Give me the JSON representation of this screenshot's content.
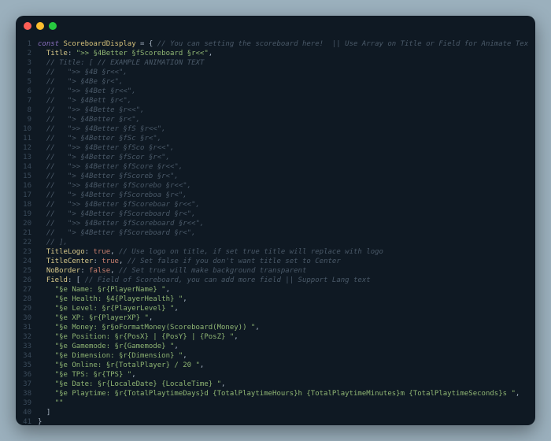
{
  "traffic_lights": [
    "red",
    "yellow",
    "green"
  ],
  "code": {
    "lines": [
      {
        "n": 1,
        "tokens": [
          {
            "c": "t-kw",
            "t": "const "
          },
          {
            "c": "t-var",
            "t": "ScoreboardDisplay"
          },
          {
            "c": "t-punc",
            "t": " = { "
          },
          {
            "c": "t-cmt",
            "t": "// You can setting the scoreboard here!  || Use Array on Title or Field for Animate Text"
          }
        ]
      },
      {
        "n": 2,
        "tokens": [
          {
            "c": "t-punc",
            "t": "  "
          },
          {
            "c": "t-prop",
            "t": "Title"
          },
          {
            "c": "t-punc",
            "t": ": "
          },
          {
            "c": "t-str",
            "t": "\">> §4Better §fScoreboard §r<<\""
          },
          {
            "c": "t-punc",
            "t": ","
          }
        ]
      },
      {
        "n": 3,
        "tokens": [
          {
            "c": "t-punc",
            "t": "  "
          },
          {
            "c": "t-cmt",
            "t": "// Title: [ // EXAMPLE ANIMATION TEXT"
          }
        ]
      },
      {
        "n": 4,
        "tokens": [
          {
            "c": "t-punc",
            "t": "  "
          },
          {
            "c": "t-cmt",
            "t": "//   \">> §4B §r<<\","
          }
        ]
      },
      {
        "n": 5,
        "tokens": [
          {
            "c": "t-punc",
            "t": "  "
          },
          {
            "c": "t-cmt",
            "t": "//   \"> §4Be §r<\","
          }
        ]
      },
      {
        "n": 6,
        "tokens": [
          {
            "c": "t-punc",
            "t": "  "
          },
          {
            "c": "t-cmt",
            "t": "//   \">> §4Bet §r<<\","
          }
        ]
      },
      {
        "n": 7,
        "tokens": [
          {
            "c": "t-punc",
            "t": "  "
          },
          {
            "c": "t-cmt",
            "t": "//   \"> §4Bett §r<\","
          }
        ]
      },
      {
        "n": 8,
        "tokens": [
          {
            "c": "t-punc",
            "t": "  "
          },
          {
            "c": "t-cmt",
            "t": "//   \">> §4Bette §r<<\","
          }
        ]
      },
      {
        "n": 9,
        "tokens": [
          {
            "c": "t-punc",
            "t": "  "
          },
          {
            "c": "t-cmt",
            "t": "//   \"> §4Better §r<\","
          }
        ]
      },
      {
        "n": 10,
        "tokens": [
          {
            "c": "t-punc",
            "t": "  "
          },
          {
            "c": "t-cmt",
            "t": "//   \">> §4Better §fS §r<<\","
          }
        ]
      },
      {
        "n": 11,
        "tokens": [
          {
            "c": "t-punc",
            "t": "  "
          },
          {
            "c": "t-cmt",
            "t": "//   \"> §4Better §fSc §r<\","
          }
        ]
      },
      {
        "n": 12,
        "tokens": [
          {
            "c": "t-punc",
            "t": "  "
          },
          {
            "c": "t-cmt",
            "t": "//   \">> §4Better §fSco §r<<\","
          }
        ]
      },
      {
        "n": 13,
        "tokens": [
          {
            "c": "t-punc",
            "t": "  "
          },
          {
            "c": "t-cmt",
            "t": "//   \"> §4Better §fScor §r<\","
          }
        ]
      },
      {
        "n": 14,
        "tokens": [
          {
            "c": "t-punc",
            "t": "  "
          },
          {
            "c": "t-cmt",
            "t": "//   \">> §4Better §fScore §r<<\","
          }
        ]
      },
      {
        "n": 15,
        "tokens": [
          {
            "c": "t-punc",
            "t": "  "
          },
          {
            "c": "t-cmt",
            "t": "//   \"> §4Better §fScoreb §r<\","
          }
        ]
      },
      {
        "n": 16,
        "tokens": [
          {
            "c": "t-punc",
            "t": "  "
          },
          {
            "c": "t-cmt",
            "t": "//   \">> §4Better §fScorebo §r<<\","
          }
        ]
      },
      {
        "n": 17,
        "tokens": [
          {
            "c": "t-punc",
            "t": "  "
          },
          {
            "c": "t-cmt",
            "t": "//   \"> §4Better §fScoreboa §r<\","
          }
        ]
      },
      {
        "n": 18,
        "tokens": [
          {
            "c": "t-punc",
            "t": "  "
          },
          {
            "c": "t-cmt",
            "t": "//   \">> §4Better §fScoreboar §r<<\","
          }
        ]
      },
      {
        "n": 19,
        "tokens": [
          {
            "c": "t-punc",
            "t": "  "
          },
          {
            "c": "t-cmt",
            "t": "//   \"> §4Better §fScoreboard §r<\","
          }
        ]
      },
      {
        "n": 20,
        "tokens": [
          {
            "c": "t-punc",
            "t": "  "
          },
          {
            "c": "t-cmt",
            "t": "//   \">> §4Better §fScoreboard §r<<\","
          }
        ]
      },
      {
        "n": 21,
        "tokens": [
          {
            "c": "t-punc",
            "t": "  "
          },
          {
            "c": "t-cmt",
            "t": "//   \"> §4Better §fScoreboard §r<\","
          }
        ]
      },
      {
        "n": 22,
        "tokens": [
          {
            "c": "t-punc",
            "t": "  "
          },
          {
            "c": "t-cmt",
            "t": "// ],"
          }
        ]
      },
      {
        "n": 23,
        "tokens": [
          {
            "c": "t-punc",
            "t": "  "
          },
          {
            "c": "t-prop",
            "t": "TitleLogo"
          },
          {
            "c": "t-punc",
            "t": ": "
          },
          {
            "c": "t-bool",
            "t": "true"
          },
          {
            "c": "t-punc",
            "t": ", "
          },
          {
            "c": "t-cmt",
            "t": "// Use logo on title, if set true title will replace with logo"
          }
        ]
      },
      {
        "n": 24,
        "tokens": [
          {
            "c": "t-punc",
            "t": "  "
          },
          {
            "c": "t-prop",
            "t": "TitleCenter"
          },
          {
            "c": "t-punc",
            "t": ": "
          },
          {
            "c": "t-bool",
            "t": "true"
          },
          {
            "c": "t-punc",
            "t": ", "
          },
          {
            "c": "t-cmt",
            "t": "// Set false if you don't want title set to Center"
          }
        ]
      },
      {
        "n": 25,
        "tokens": [
          {
            "c": "t-punc",
            "t": "  "
          },
          {
            "c": "t-prop",
            "t": "NoBorder"
          },
          {
            "c": "t-punc",
            "t": ": "
          },
          {
            "c": "t-bool",
            "t": "false"
          },
          {
            "c": "t-punc",
            "t": ", "
          },
          {
            "c": "t-cmt",
            "t": "// Set true will make background transparent"
          }
        ]
      },
      {
        "n": 26,
        "tokens": [
          {
            "c": "t-punc",
            "t": "  "
          },
          {
            "c": "t-prop",
            "t": "Field"
          },
          {
            "c": "t-punc",
            "t": ": [ "
          },
          {
            "c": "t-cmt",
            "t": "// Field of Scoreboard, you can add more field || Support Lang text"
          }
        ]
      },
      {
        "n": 27,
        "tokens": [
          {
            "c": "t-punc",
            "t": "    "
          },
          {
            "c": "t-str",
            "t": "\"§e Name: §r{PlayerName} \""
          },
          {
            "c": "t-punc",
            "t": ","
          }
        ]
      },
      {
        "n": 28,
        "tokens": [
          {
            "c": "t-punc",
            "t": "    "
          },
          {
            "c": "t-str",
            "t": "\"§e Health: §4{PlayerHealth} \""
          },
          {
            "c": "t-punc",
            "t": ","
          }
        ]
      },
      {
        "n": 29,
        "tokens": [
          {
            "c": "t-punc",
            "t": "    "
          },
          {
            "c": "t-str",
            "t": "\"§e Level: §r{PlayerLevel} \""
          },
          {
            "c": "t-punc",
            "t": ","
          }
        ]
      },
      {
        "n": 30,
        "tokens": [
          {
            "c": "t-punc",
            "t": "    "
          },
          {
            "c": "t-str",
            "t": "\"§e XP: §r{PlayerXP} \""
          },
          {
            "c": "t-punc",
            "t": ","
          }
        ]
      },
      {
        "n": 31,
        "tokens": [
          {
            "c": "t-punc",
            "t": "    "
          },
          {
            "c": "t-str",
            "t": "\"§e Money: §r§oFormatMoney(Scoreboard(Money)) \""
          },
          {
            "c": "t-punc",
            "t": ","
          }
        ]
      },
      {
        "n": 32,
        "tokens": [
          {
            "c": "t-punc",
            "t": "    "
          },
          {
            "c": "t-str",
            "t": "\"§e Position: §r{PosX} | {PosY} | {PosZ} \""
          },
          {
            "c": "t-punc",
            "t": ","
          }
        ]
      },
      {
        "n": 33,
        "tokens": [
          {
            "c": "t-punc",
            "t": "    "
          },
          {
            "c": "t-str",
            "t": "\"§e Gamemode: §r{Gamemode} \""
          },
          {
            "c": "t-punc",
            "t": ","
          }
        ]
      },
      {
        "n": 34,
        "tokens": [
          {
            "c": "t-punc",
            "t": "    "
          },
          {
            "c": "t-str",
            "t": "\"§e Dimension: §r{Dimension} \""
          },
          {
            "c": "t-punc",
            "t": ","
          }
        ]
      },
      {
        "n": 35,
        "tokens": [
          {
            "c": "t-punc",
            "t": "    "
          },
          {
            "c": "t-str",
            "t": "\"§e Online: §r{TotalPlayer} / 20 \""
          },
          {
            "c": "t-punc",
            "t": ","
          }
        ]
      },
      {
        "n": 36,
        "tokens": [
          {
            "c": "t-punc",
            "t": "    "
          },
          {
            "c": "t-str",
            "t": "\"§e TPS: §r{TPS} \""
          },
          {
            "c": "t-punc",
            "t": ","
          }
        ]
      },
      {
        "n": 37,
        "tokens": [
          {
            "c": "t-punc",
            "t": "    "
          },
          {
            "c": "t-str",
            "t": "\"§e Date: §r{LocaleDate} {LocaleTime} \""
          },
          {
            "c": "t-punc",
            "t": ","
          }
        ]
      },
      {
        "n": 38,
        "tokens": [
          {
            "c": "t-punc",
            "t": "    "
          },
          {
            "c": "t-str",
            "t": "\"§e Playtime: §r{TotalPlaytimeDays}d {TotalPlaytimeHours}h {TotalPlaytimeMinutes}m {TotalPlaytimeSeconds}s \""
          },
          {
            "c": "t-punc",
            "t": ","
          }
        ]
      },
      {
        "n": 39,
        "tokens": [
          {
            "c": "t-punc",
            "t": "    "
          },
          {
            "c": "t-str",
            "t": "\"\""
          }
        ]
      },
      {
        "n": 40,
        "tokens": [
          {
            "c": "t-punc",
            "t": "  ]"
          }
        ]
      },
      {
        "n": 41,
        "tokens": [
          {
            "c": "t-punc",
            "t": "}"
          }
        ]
      }
    ]
  }
}
